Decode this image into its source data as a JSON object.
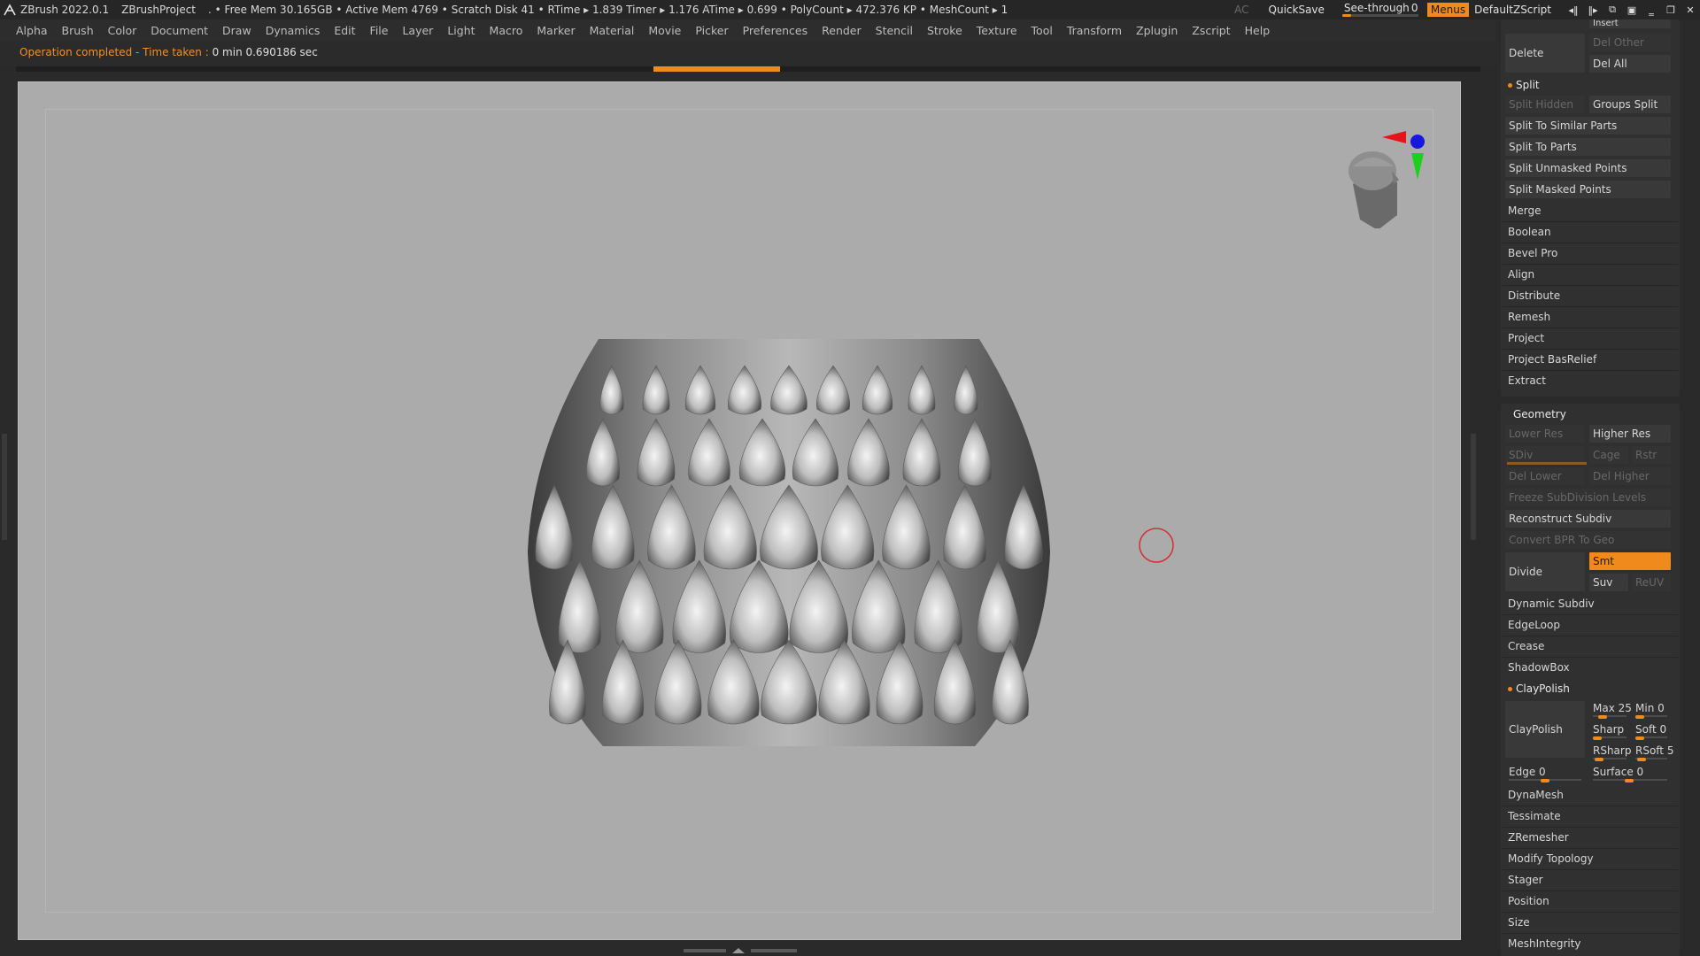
{
  "titlebar": {
    "app": "ZBrush 2022.0.1",
    "project": "ZBrushProject",
    "stats": ". • Free Mem 30.165GB • Active Mem 4769 • Scratch Disk 41 •  RTime ▸ 1.839 Timer ▸ 1.176 ATime ▸ 0.699 • PolyCount ▸ 472.376 KP  • MeshCount ▸ 1",
    "ac": "AC",
    "quicksave": "QuickSave",
    "see_through_label": "See-through",
    "see_through_value": "0",
    "menus": "Menus",
    "script": "DefaultZScript"
  },
  "menubar": [
    "Alpha",
    "Brush",
    "Color",
    "Document",
    "Draw",
    "Dynamics",
    "Edit",
    "File",
    "Layer",
    "Light",
    "Macro",
    "Marker",
    "Material",
    "Movie",
    "Picker",
    "Preferences",
    "Render",
    "Stencil",
    "Stroke",
    "Texture",
    "Tool",
    "Transform",
    "Zplugin",
    "Zscript",
    "Help"
  ],
  "notice": {
    "prefix": "Operation completed - Time taken : ",
    "value": "0 min 0.690186 sec"
  },
  "panel": {
    "insert": "Insert",
    "delete": "Delete",
    "del_other": "Del Other",
    "del_all": "Del All",
    "split": "Split",
    "split_hidden": "Split Hidden",
    "groups_split": "Groups Split",
    "split_similar": "Split To Similar Parts",
    "split_parts": "Split To Parts",
    "split_unmasked": "Split Unmasked Points",
    "split_masked": "Split Masked Points",
    "merge": "Merge",
    "boolean": "Boolean",
    "bevel_pro": "Bevel Pro",
    "align": "Align",
    "distribute": "Distribute",
    "remesh": "Remesh",
    "project": "Project",
    "project_basrelief": "Project BasRelief",
    "extract": "Extract",
    "geometry": "Geometry",
    "lower_res": "Lower Res",
    "higher_res": "Higher Res",
    "sdiv": "SDiv",
    "cage": "Cage",
    "rstr": "Rstr",
    "del_lower": "Del Lower",
    "del_higher": "Del Higher",
    "freeze_subdiv": "Freeze SubDivision Levels",
    "reconstruct_subdiv": "Reconstruct Subdiv",
    "convert_bpr": "Convert BPR To Geo",
    "divide": "Divide",
    "smt": "Smt",
    "suv": "Suv",
    "reuv": "ReUV",
    "dynamic_subdiv": "Dynamic Subdiv",
    "edgeloop": "EdgeLoop",
    "crease": "Crease",
    "shadowbox": "ShadowBox",
    "claypolish_head": "ClayPolish",
    "claypolish_btn": "ClayPolish",
    "max": "Max 25",
    "min": "Min 0",
    "sharp": "Sharp",
    "soft": "Soft 0",
    "rsharp": "RSharp",
    "rsoft": "RSoft 5",
    "edge": "Edge 0",
    "surface": "Surface 0",
    "dynamesh": "DynaMesh",
    "tessimate": "Tessimate",
    "zremesher": "ZRemesher",
    "modify_topology": "Modify Topology",
    "stager": "Stager",
    "position": "Position",
    "size": "Size",
    "meshintegrity": "MeshIntegrity"
  },
  "colors": {
    "accent": "#f08a1c",
    "viewport_bg": "#ababab",
    "panel_bg": "#2a2a2a",
    "gizmo_x": "#e5141b",
    "gizmo_y": "#1cd11c",
    "gizmo_z": "#1717e0",
    "cursor": "#d23030"
  },
  "icons": [
    "zbrush-logo-icon",
    "draw-size-left-icon",
    "draw-size-right-icon",
    "layout-icon",
    "palette-icon",
    "minimize-icon",
    "restore-icon",
    "close-icon",
    "orientation-head-icon",
    "axis-gizmo-icon",
    "brush-cursor-icon"
  ]
}
